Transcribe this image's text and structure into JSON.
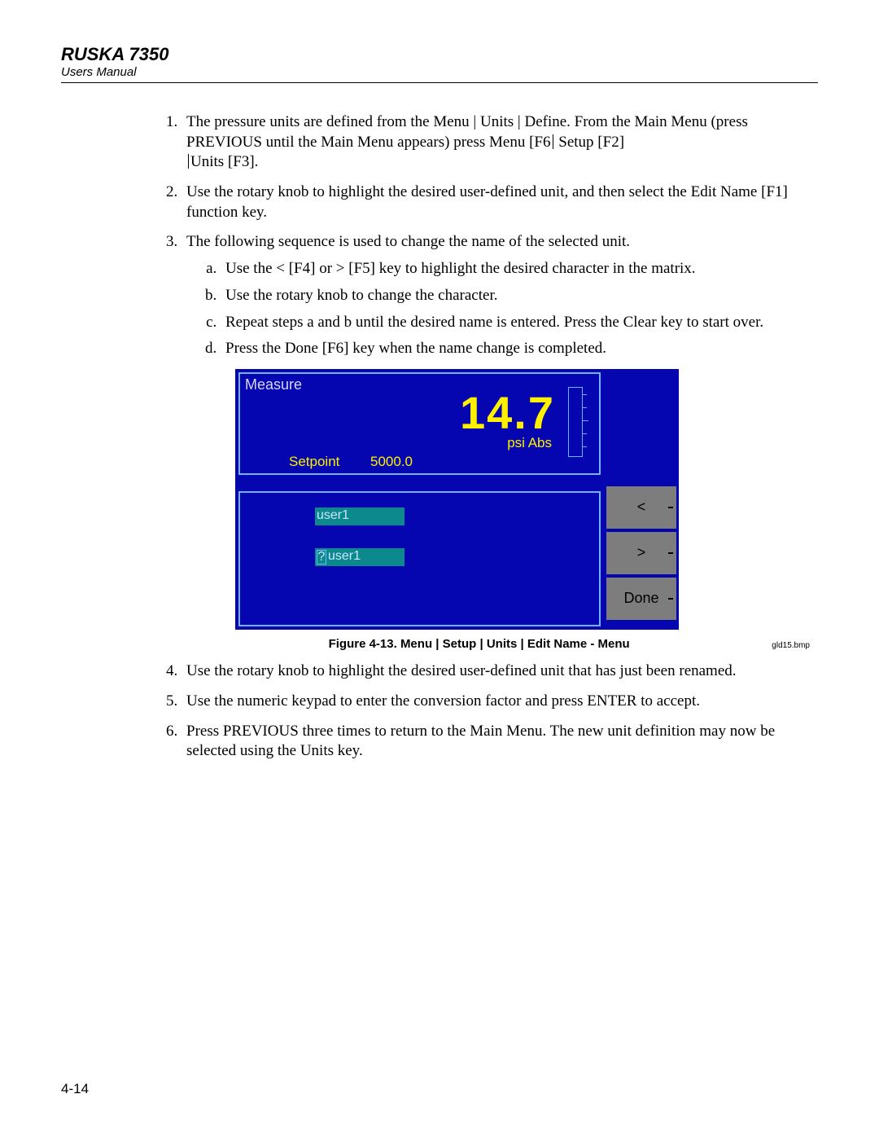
{
  "header": {
    "title": "RUSKA 7350",
    "subtitle": "Users Manual"
  },
  "page_number": "4-14",
  "caption": "Figure 4-13. Menu | Setup | Units | Edit Name - Menu",
  "bmp_label": "gld15.bmp",
  "steps": {
    "s1a": "The pressure units are defined from the Menu | Units | Define. From the Main Menu (press PREVIOUS until the Main Menu appears) press Menu [F6",
    "s1b": "Setup [F2]",
    "s1c": "Units [F3].",
    "s2": "Use the rotary knob to highlight the desired user-defined unit, and then select the Edit Name [F1] function key.",
    "s3": "The following sequence is used to change the name of the selected unit.",
    "s3a": "Use the < [F4] or > [F5] key to highlight the desired character in the matrix.",
    "s3b": "Use the rotary knob to change the character.",
    "s3c": "Repeat steps a and b until the desired name is entered. Press the Clear key to start over.",
    "s3d": "Press the Done [F6] key when the name change is completed.",
    "s4": "Use the rotary knob to highlight the desired user-defined unit that has just been renamed.",
    "s5": "Use the numeric keypad to enter the conversion factor and press ENTER to accept.",
    "s6": "Press PREVIOUS three times to return to the Main Menu. The new unit definition may now be selected using the Units key."
  },
  "device": {
    "measure_label": "Measure",
    "value": "14.7",
    "units": "psi Abs",
    "setpoint_label": "Setpoint",
    "setpoint_value": "5000.0",
    "field1": "user1",
    "field2_cursor": "?",
    "field2_text": "user1",
    "fk_prev": "<",
    "fk_next": ">",
    "fk_done": "Done"
  }
}
